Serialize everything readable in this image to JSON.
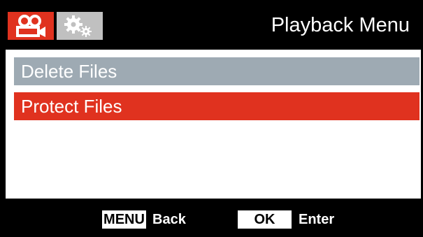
{
  "header": {
    "title": "Playback Menu",
    "tabs": [
      {
        "name": "video-tab",
        "icon": "camcorder-icon",
        "color": "#e0321f",
        "active": true
      },
      {
        "name": "settings-tab",
        "icon": "gears-icon",
        "color": "#c0c0c0",
        "active": false
      }
    ]
  },
  "menu": {
    "items": [
      {
        "label": "Delete Files",
        "state": "normal",
        "color": "#9eaab3"
      },
      {
        "label": "Protect Files",
        "state": "selected",
        "color": "#e0321f"
      }
    ]
  },
  "footer": {
    "menu_key": "MENU",
    "menu_action": "Back",
    "ok_key": "OK",
    "ok_action": "Enter"
  }
}
